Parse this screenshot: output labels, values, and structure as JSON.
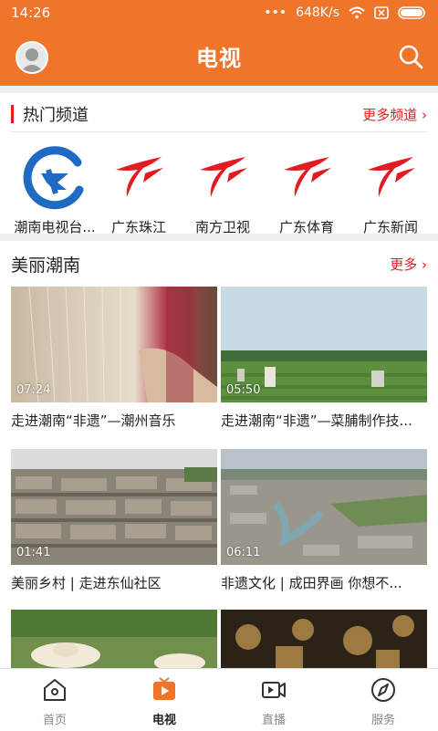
{
  "status": {
    "time": "14:26",
    "speed": "648K/s"
  },
  "header": {
    "title": "电视"
  },
  "hot": {
    "title": "热门频道",
    "more": "更多频道"
  },
  "channels": [
    {
      "name": "潮南电视台..."
    },
    {
      "name": "广东珠江"
    },
    {
      "name": "南方卫视"
    },
    {
      "name": "广东体育"
    },
    {
      "name": "广东新闻"
    }
  ],
  "beauty": {
    "title": "美丽潮南",
    "more": "更多"
  },
  "videos": [
    {
      "title": "走进潮南“非遗”—潮州音乐",
      "duration": "07:24"
    },
    {
      "title": "走进潮南“非遗”—菜脯制作技...",
      "duration": "05:50"
    },
    {
      "title": "美丽乡村 | 走进东仙社区",
      "duration": "01:41"
    },
    {
      "title": "非遗文化 | 成田界画 你想不...",
      "duration": "06:11"
    },
    {
      "title": "",
      "duration": ""
    },
    {
      "title": "",
      "duration": ""
    }
  ],
  "tabs": [
    {
      "label": "首页",
      "icon": "home-icon"
    },
    {
      "label": "电视",
      "icon": "tv-icon"
    },
    {
      "label": "直播",
      "icon": "video-icon"
    },
    {
      "label": "服务",
      "icon": "compass-icon"
    }
  ],
  "colors": {
    "accent": "#f0752b",
    "red": "#e21c1c"
  }
}
